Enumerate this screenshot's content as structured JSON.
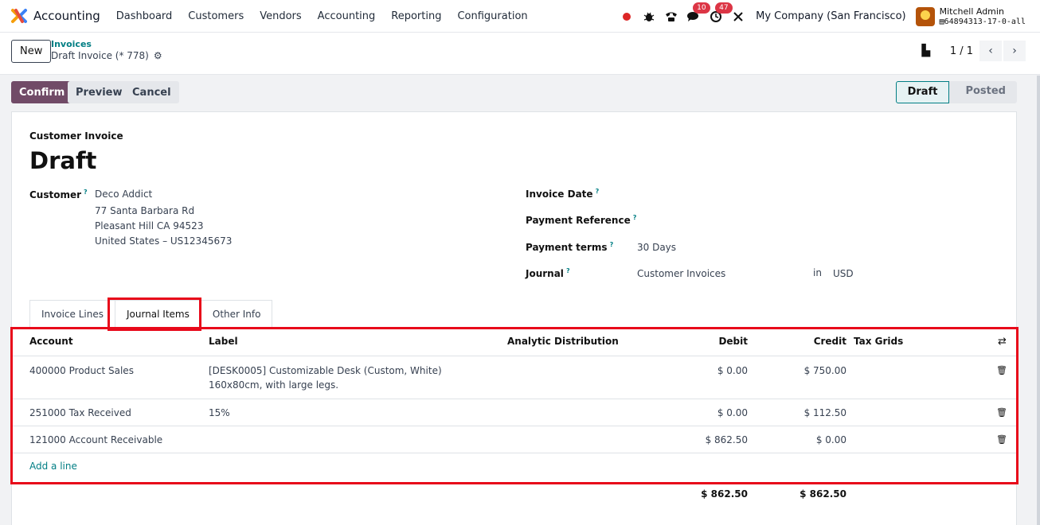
{
  "navbar": {
    "app_name": "Accounting",
    "menu": [
      "Dashboard",
      "Customers",
      "Vendors",
      "Accounting",
      "Reporting",
      "Configuration"
    ],
    "messages_count": "10",
    "activities_count": "47",
    "company": "My Company (San Francisco)",
    "user_name": "Mitchell Admin",
    "database": "64894313-17-0-all",
    "icons": [
      "record-dot-icon",
      "bug-icon",
      "phone-icon",
      "chat-icon",
      "clock-icon",
      "tools-icon"
    ],
    "colors": {
      "record": "#dc2626",
      "badge": "#dc3545"
    }
  },
  "control_panel": {
    "new_label": "New",
    "breadcrumb_parent": "Invoices",
    "breadcrumb_current": "Draft Invoice (* 778)",
    "pager": "1 / 1"
  },
  "actions": {
    "confirm": "Confirm",
    "preview": "Preview",
    "cancel": "Cancel",
    "colors": {
      "primary": "#714b67"
    }
  },
  "status": {
    "steps": [
      "Draft",
      "Posted"
    ],
    "active": "Draft"
  },
  "form": {
    "subtitle": "Customer Invoice",
    "title": "Draft",
    "customer_label": "Customer",
    "customer_name": "Deco Addict",
    "customer_address": [
      "77 Santa Barbara Rd",
      "Pleasant Hill CA 94523",
      "United States – US12345673"
    ],
    "invoice_date_label": "Invoice Date",
    "payment_ref_label": "Payment Reference",
    "payment_terms_label": "Payment terms",
    "payment_terms_value": "30 Days",
    "journal_label": "Journal",
    "journal_value": "Customer Invoices",
    "in_label": "in",
    "currency": "USD",
    "help_mark": "?"
  },
  "tabs": [
    "Invoice Lines",
    "Journal Items",
    "Other Info"
  ],
  "active_tab": "Journal Items",
  "journal_items": {
    "columns": [
      "Account",
      "Label",
      "Analytic Distribution",
      "Debit",
      "Credit",
      "Tax Grids"
    ],
    "rows": [
      {
        "account": "400000 Product Sales",
        "label_1": "[DESK0005] Customizable Desk (Custom, White)",
        "label_2": "160x80cm, with large legs.",
        "debit": "$ 0.00",
        "credit": "$ 750.00"
      },
      {
        "account": "251000 Tax Received",
        "label_1": "15%",
        "label_2": "",
        "debit": "$ 0.00",
        "credit": "$ 112.50"
      },
      {
        "account": "121000 Account Receivable",
        "label_1": "",
        "label_2": "",
        "debit": "$ 862.50",
        "credit": "$ 0.00"
      }
    ],
    "add_line": "Add a line",
    "total_debit": "$ 862.50",
    "total_credit": "$ 862.50"
  },
  "highlight_color": "#e8091a"
}
